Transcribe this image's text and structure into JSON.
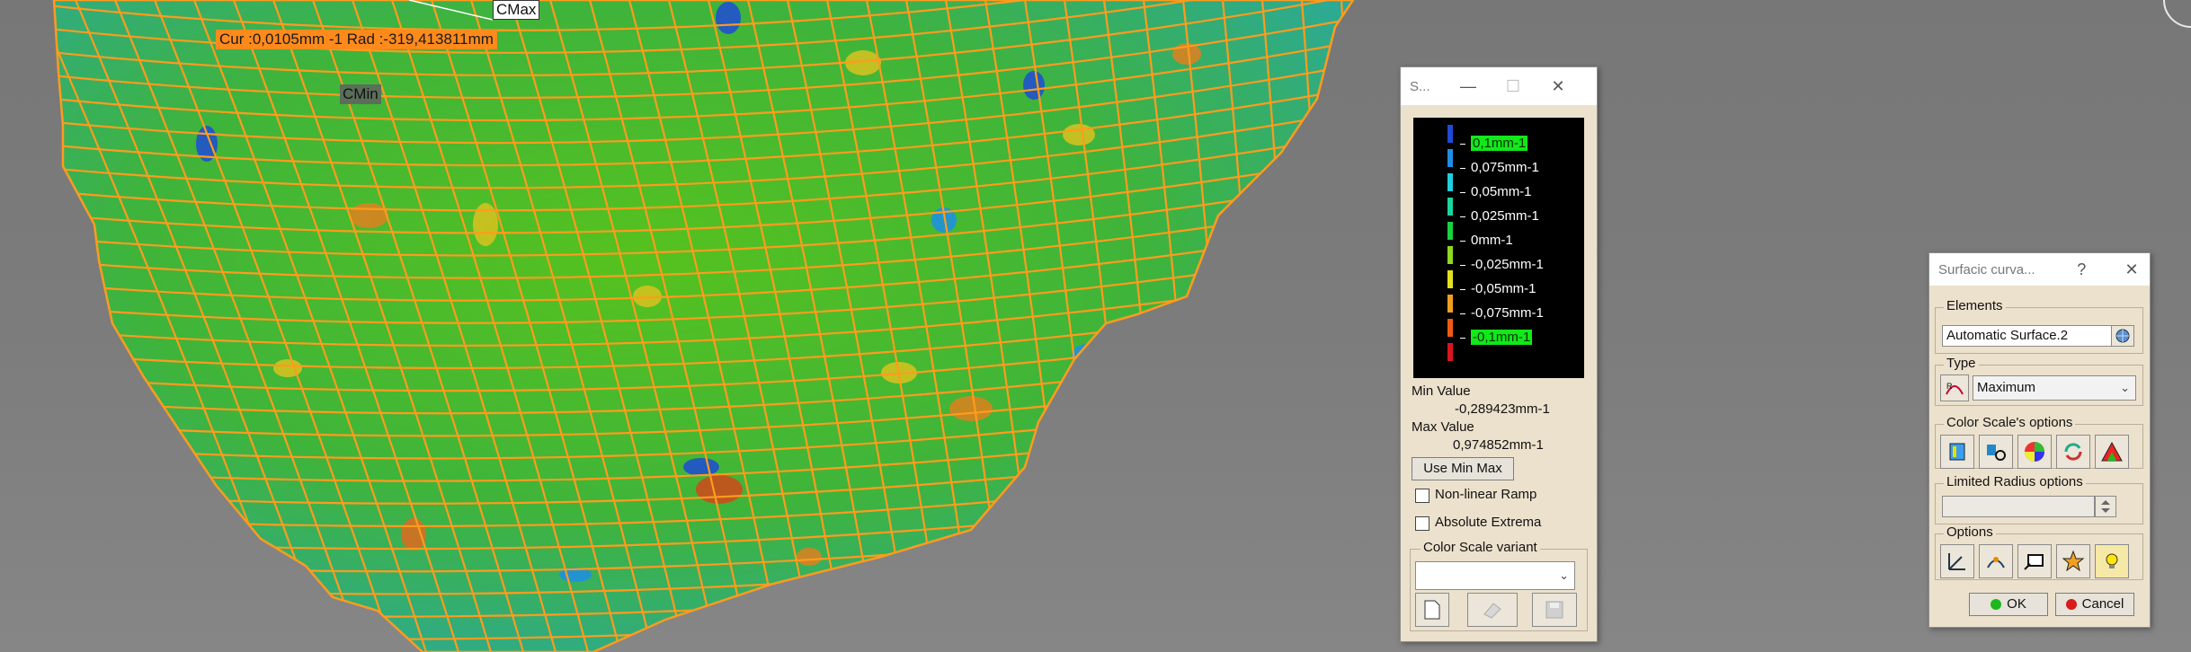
{
  "viewport": {
    "cur_label": "Cur :0,0105mm -1  Rad :-319,413811mm",
    "cmax_label": "CMax",
    "cmin_label": "CMin"
  },
  "scale_window": {
    "title": "S...",
    "scale_labels": [
      "0,1mm-1",
      "0,075mm-1",
      "0,05mm-1",
      "0,025mm-1",
      "0mm-1",
      "-0,025mm-1",
      "-0,05mm-1",
      "-0,075mm-1",
      "-0,1mm-1"
    ],
    "scale_colors": [
      "#1e4bd6",
      "#1e8ee6",
      "#1ecfe0",
      "#19d6a0",
      "#19d23c",
      "#8ed81e",
      "#e3e01e",
      "#f0a01e",
      "#ee5a14",
      "#d9141e"
    ],
    "min_value_label": "Min Value",
    "min_value": "-0,289423mm-1",
    "max_value_label": "Max Value",
    "max_value": "0,974852mm-1",
    "use_min_max_button": "Use Min Max",
    "nonlinear_ramp_label": "Non-linear Ramp",
    "absolute_extrema_label": "Absolute Extrema",
    "color_scale_variant_label": "Color Scale variant",
    "color_scale_variant_value": ""
  },
  "curvature_window": {
    "title": "Surfacic curva...",
    "help": "?",
    "elements_label": "Elements",
    "elements_value": "Automatic Surface.2",
    "type_label": "Type",
    "type_value": "Maximum",
    "color_scale_options_label": "Color Scale's options",
    "limited_radius_label": "Limited Radius options",
    "limited_radius_value": "",
    "options_label": "Options",
    "ok_button": "OK",
    "cancel_button": "Cancel"
  }
}
